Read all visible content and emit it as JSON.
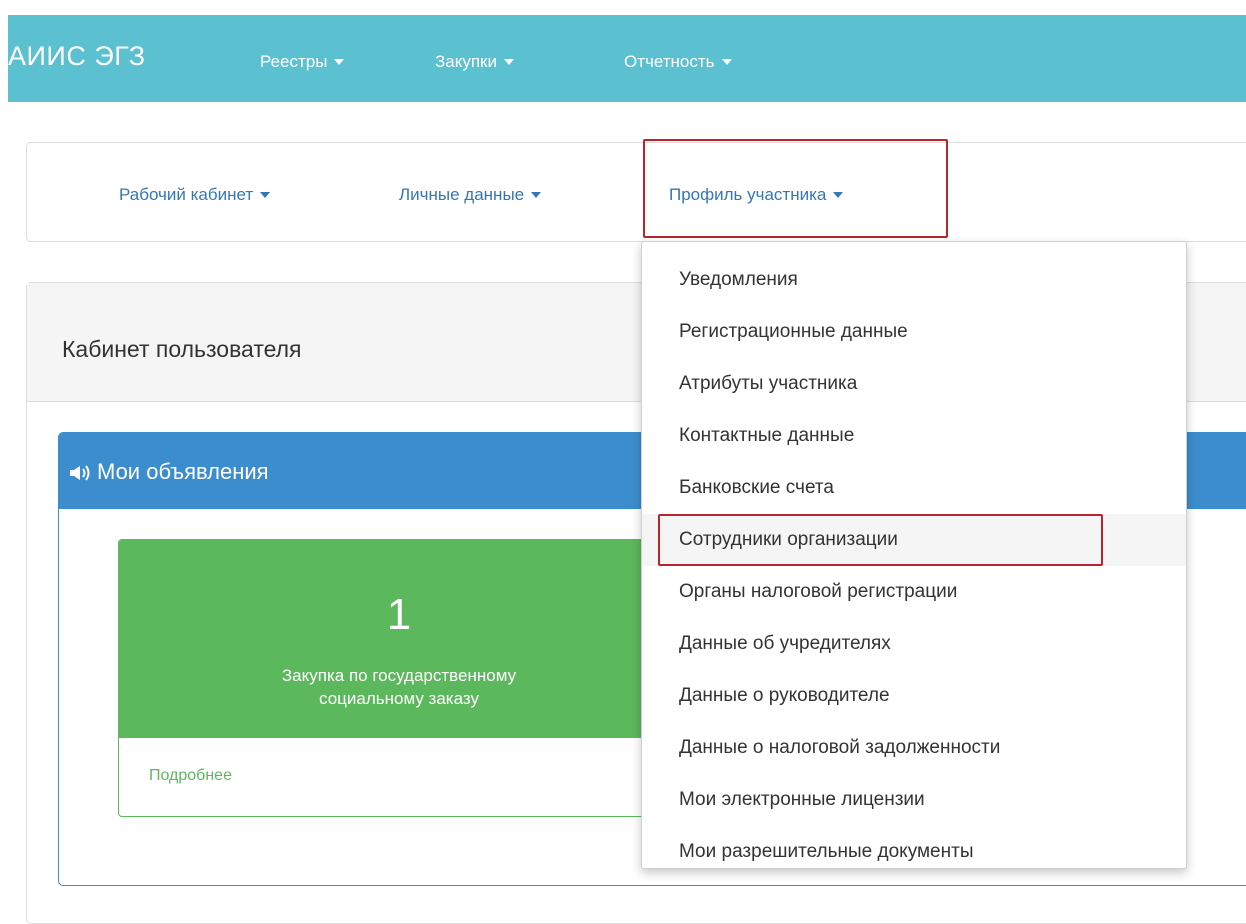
{
  "navbar": {
    "brand": "АИИС ЭГЗ",
    "menus": [
      {
        "label": "Реестры"
      },
      {
        "label": "Закупки"
      },
      {
        "label": "Отчетность"
      }
    ]
  },
  "subnav": {
    "items": [
      {
        "label": "Рабочий кабинет"
      },
      {
        "label": "Личные данные"
      },
      {
        "label": "Профиль участника"
      }
    ]
  },
  "main": {
    "title": "Кабинет пользователя",
    "announcements": {
      "title": "Мои объявления",
      "card": {
        "count": "1",
        "description_line1": "Закупка по государственному",
        "description_line2": "социальному заказу",
        "link": "Подробнее",
        "arrow": "⏩"
      }
    }
  },
  "dropdown": {
    "items": [
      {
        "label": "Уведомления"
      },
      {
        "label": "Регистрационные данные"
      },
      {
        "label": "Атрибуты участника"
      },
      {
        "label": "Контактные данные"
      },
      {
        "label": "Банковские счета"
      },
      {
        "label": "Сотрудники организации"
      },
      {
        "label": "Органы налоговой регистрации"
      },
      {
        "label": "Данные об учредителях"
      },
      {
        "label": "Данные о руководителе"
      },
      {
        "label": "Данные о налоговой задолженности"
      },
      {
        "label": "Мои электронные лицензии"
      },
      {
        "label": "Мои разрешительные документы"
      }
    ]
  },
  "colors": {
    "navbar": "#5bc0d0",
    "link": "#3377b8",
    "panel_primary": "#3c8dce",
    "success": "#5cb85c",
    "highlight_border": "#b7262c"
  }
}
